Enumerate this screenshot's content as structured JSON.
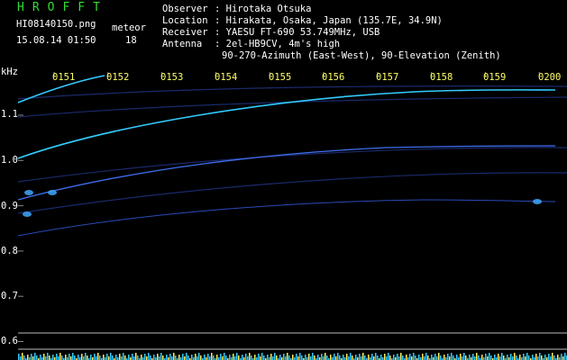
{
  "header": {
    "app_title": "HROFFT",
    "filename": "HI08140150.png",
    "datetime": "15.08.14 01:50",
    "count_label": "meteor",
    "count_value": "18",
    "observer_label": "Observer",
    "observer": "Hirotaka Otsuka",
    "location_label": "Location",
    "location": "Hirakata, Osaka, Japan (135.7E, 34.9N)",
    "receiver_label": "Receiver",
    "receiver": "YAESU FT-690 53.749MHz, USB",
    "antenna_label": "Antenna",
    "antenna": "2el-HB9CV, 4m's high",
    "antenna_detail": "90-270-Azimuth (East-West), 90-Elevation (Zenith)"
  },
  "plot": {
    "unit": "kHz",
    "time_ticks": [
      "0151",
      "0152",
      "0153",
      "0154",
      "0155",
      "0156",
      "0157",
      "0158",
      "0159",
      "0200"
    ],
    "freq_ticks": [
      "1.1",
      "1.0",
      "0.9",
      "0.8",
      "0.7",
      "0.6"
    ]
  },
  "colors": {
    "title": "#33dd33",
    "header_text": "#ffffff",
    "time_ticks": "#ffff66",
    "freq_ticks": "#ffffff",
    "trace": "#33ccff",
    "baseline": "#bbbbbb",
    "spectrum": "#ffee55"
  }
}
